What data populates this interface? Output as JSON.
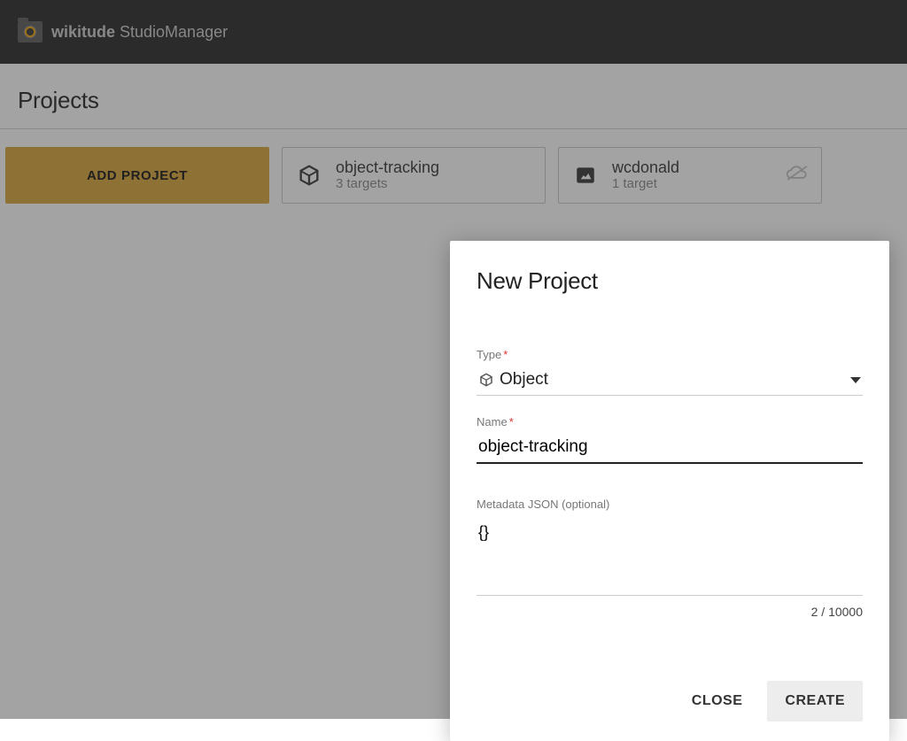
{
  "header": {
    "brand_bold": "wikitude",
    "brand_light": " StudioManager"
  },
  "page": {
    "title": "Projects"
  },
  "add_button": {
    "label": "ADD PROJECT"
  },
  "projects": [
    {
      "name": "object-tracking",
      "targets": "3 targets",
      "iconType": "object",
      "cloudOff": false
    },
    {
      "name": "wcdonald",
      "targets": "1 target",
      "iconType": "image",
      "cloudOff": true
    }
  ],
  "dialog": {
    "title": "New Project",
    "typeLabel": "Type",
    "typeRequired": "*",
    "typeValue": "Object",
    "nameLabel": "Name",
    "nameRequired": "*",
    "nameValue": "object-tracking",
    "metaLabel": "Metadata JSON (optional)",
    "metaValue": "{}",
    "counter": "2 / 10000",
    "closeLabel": "CLOSE",
    "createLabel": "CREATE"
  }
}
